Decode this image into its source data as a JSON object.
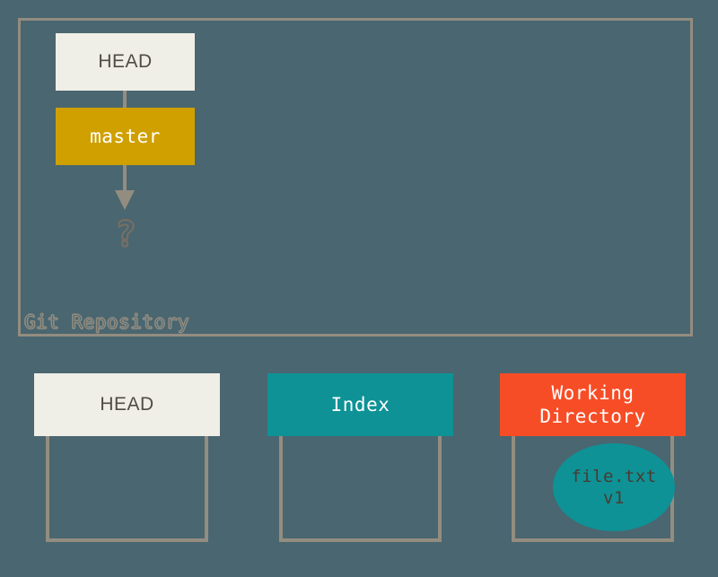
{
  "background_color": "#4a6670",
  "repository": {
    "frame_label": "Git Repository",
    "border_color": "#938d80",
    "nodes": {
      "head": {
        "label": "HEAD",
        "bg_color": "#efeee7",
        "text_color": "#504c45"
      },
      "master": {
        "label": "master",
        "bg_color": "#cfa000",
        "text_color": "#ffffff"
      },
      "unknown_commit": {
        "label": "?",
        "outline_color": "#776f63"
      }
    },
    "connectors": {
      "head_to_master": "plain-line",
      "master_to_unknown": "arrow-down"
    }
  },
  "stages": [
    {
      "id": "head",
      "header_lines": [
        "HEAD"
      ],
      "header_bg": "#efeee7",
      "header_text_color": "#504c45",
      "contents": []
    },
    {
      "id": "index",
      "header_lines": [
        "Index"
      ],
      "header_bg": "#0e9296",
      "header_text_color": "#ffffff",
      "contents": []
    },
    {
      "id": "working-directory",
      "header_lines": [
        "Working",
        "Directory"
      ],
      "header_bg": "#f74d26",
      "header_text_color": "#ffffff",
      "contents": [
        {
          "shape": "ellipse",
          "bg_color": "#0e9296",
          "text_color": "#4b3a31",
          "lines": [
            "file.txt",
            "v1"
          ]
        }
      ]
    }
  ]
}
